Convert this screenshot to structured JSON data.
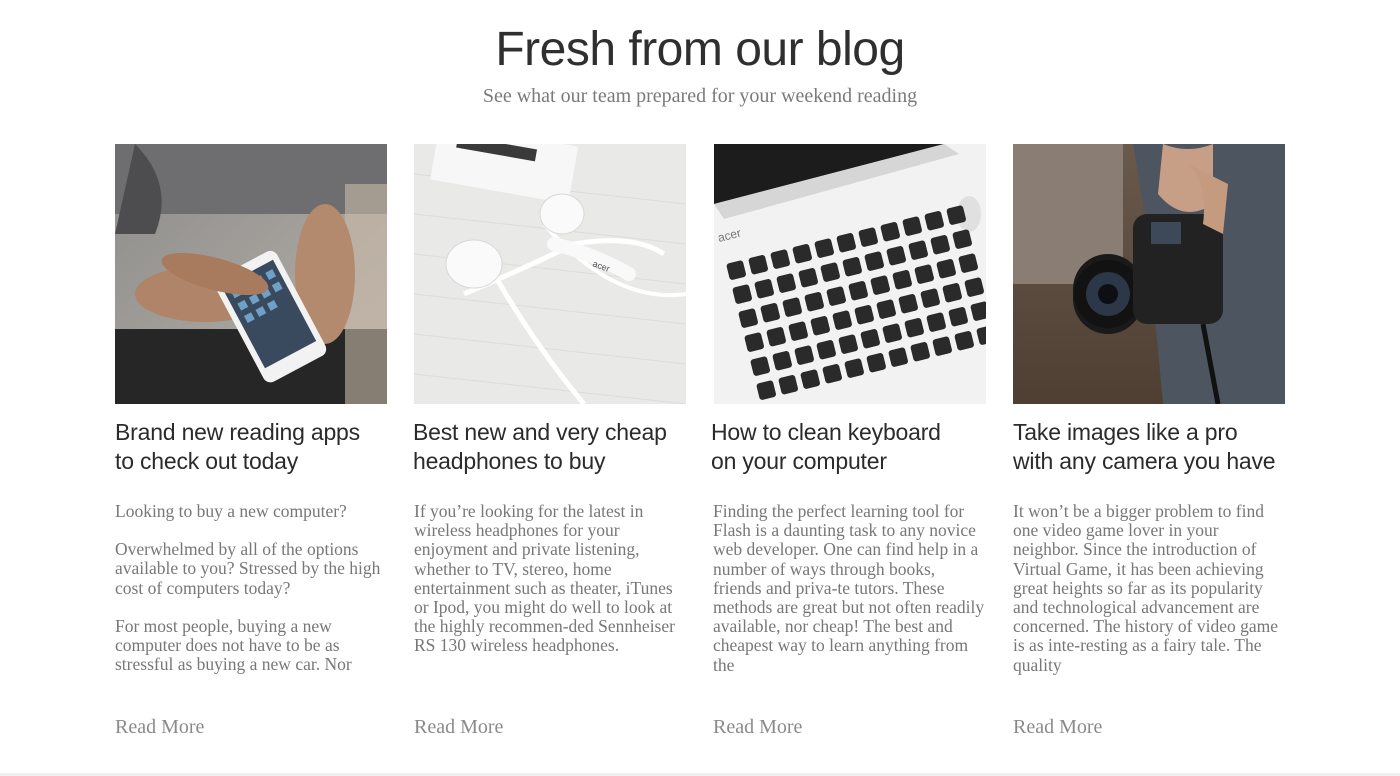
{
  "header": {
    "title": "Fresh from our blog",
    "subtitle": "See what our team prepared for your weekend reading"
  },
  "posts": [
    {
      "title_line1": "Brand new reading apps",
      "title_line2": "to check out today",
      "paragraphs": [
        "Looking to buy a new computer?",
        "Overwhelmed by all of the options available to you? Stressed by the high cost of computers today?",
        "For most people, buying a new computer does not have to be as stressful as buying a new car. Nor"
      ],
      "read_more": "Read More",
      "image_icon": "smartphone-photo"
    },
    {
      "title_line1": "Best new and very cheap",
      "title_line2": "headphones to buy",
      "paragraphs": [
        "If you’re looking for the latest in wireless headphones for your enjoyment and private listening, whether to TV, stereo, home entertainment such as theater, iTunes or Ipod, you might do well to look at the highly recommen-ded Sennheiser RS 130 wireless headphones."
      ],
      "read_more": "Read More",
      "image_icon": "earphones-photo"
    },
    {
      "title_line1": "How to clean keyboard",
      "title_line2": "on your computer",
      "paragraphs": [
        "Finding the perfect learning tool for Flash is a daunting task to any novice web developer. One can find help in a number of ways through books, friends and priva-te tutors. These methods are great but not often readily available, nor cheap! The best and cheapest way to learn anything from the"
      ],
      "read_more": "Read More",
      "image_icon": "laptop-keyboard-photo"
    },
    {
      "title_line1": "Take images like a pro",
      "title_line2": "with any camera you have",
      "paragraphs": [
        "It won’t be a bigger problem to find one video game lover in your neighbor. Since the introduction of Virtual Game, it has been achieving great heights so far as its popularity and technological advancement are concerned. The history of video game is as inte-resting as a fairy tale. The quality"
      ],
      "read_more": "Read More",
      "image_icon": "camera-photo"
    }
  ],
  "image_text": {
    "laptop_brand": "acer",
    "earphone_brand": "acer"
  }
}
